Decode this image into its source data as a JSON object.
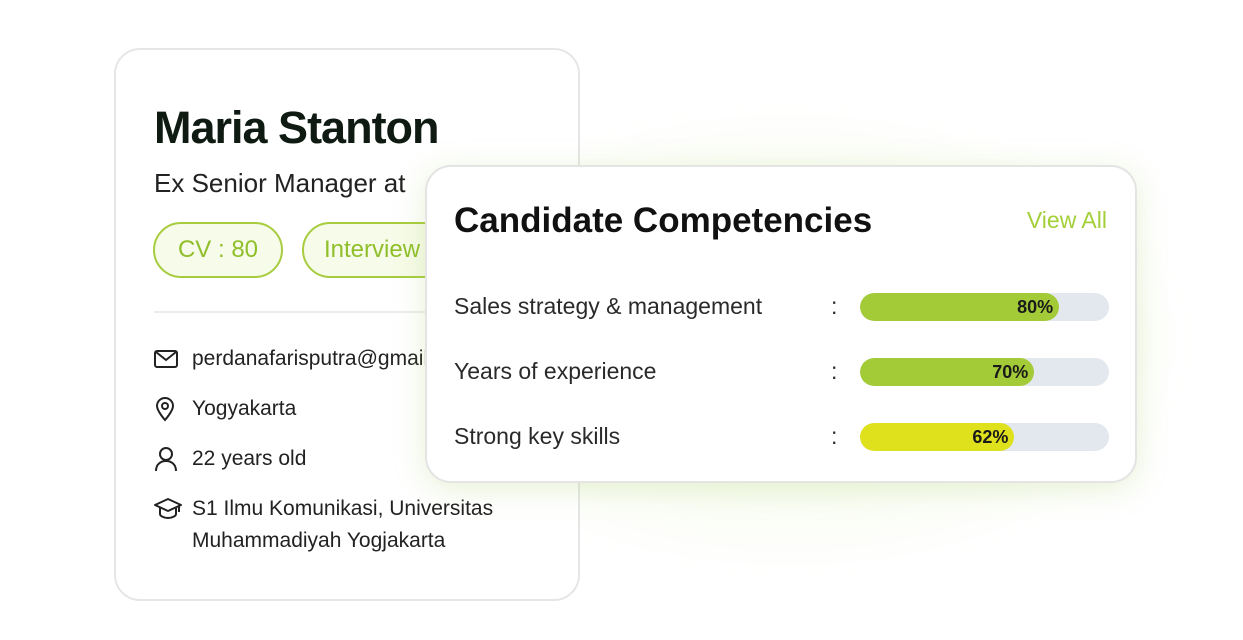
{
  "profile": {
    "name": "Maria Stanton",
    "role": "Ex Senior Manager at",
    "badges": {
      "cv": "CV : 80",
      "interview": "Interview"
    },
    "email": "perdanafarisputra@gmail.com",
    "location": "Yogyakarta",
    "age": "22 years old",
    "education": "S1 Ilmu Komunikasi, Universitas Muhammadiyah Yogjakarta",
    "icons": [
      "mail-icon",
      "location-pin-icon",
      "user-icon",
      "graduation-cap-icon"
    ]
  },
  "competencies": {
    "title": "Candidate Competencies",
    "view_all": "View All",
    "items": [
      {
        "label": "Sales strategy & management",
        "sep": ":",
        "value": 80,
        "display": "80%",
        "color": "#a3cb38"
      },
      {
        "label": "Years of experience",
        "sep": ":",
        "value": 70,
        "display": "70%",
        "color": "#a3cb38"
      },
      {
        "label": "Strong key skills",
        "sep": ":",
        "value": 62,
        "display": "62%",
        "color": "#dfe11d"
      }
    ]
  },
  "colors": {
    "accent_green": "#a3cb38",
    "accent_yellow": "#dfe11d",
    "track": "#e3e8ee"
  }
}
